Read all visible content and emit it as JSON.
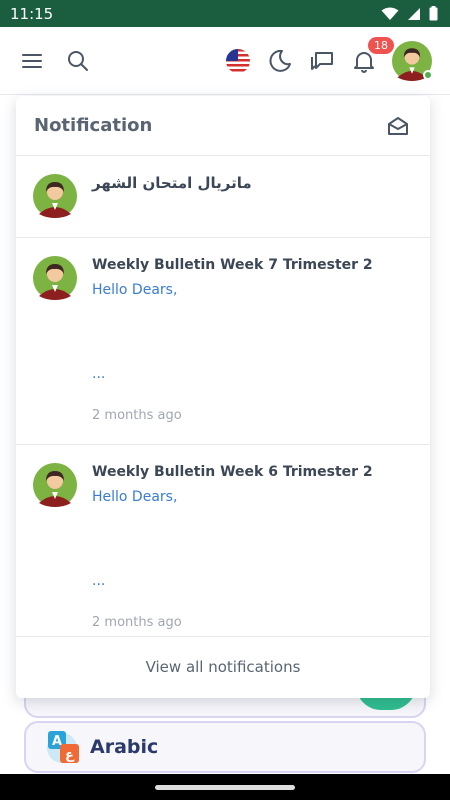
{
  "status_bar": {
    "time": "11:15"
  },
  "topbar": {
    "notification_count": "18"
  },
  "notifications": {
    "title": "Notification",
    "items": [
      {
        "title": "ماتريال امتحان الشهر",
        "text": "",
        "ellipsis": "",
        "time": ""
      },
      {
        "title": "Weekly Bulletin Week 7 Trimester 2",
        "text": "Hello Dears,",
        "ellipsis": "...",
        "time": "2 months ago"
      },
      {
        "title": "Weekly Bulletin Week 6 Trimester 2",
        "text": "Hello Dears,",
        "ellipsis": "...",
        "time": "2 months ago"
      }
    ],
    "view_all": "View all notifications"
  },
  "background": {
    "subject_card_label": "Arabic"
  },
  "colors": {
    "status_bar": "#1b5e3f",
    "link": "#3a7bd5",
    "badge": "#ef5350",
    "fab": "#2fbf8f"
  }
}
